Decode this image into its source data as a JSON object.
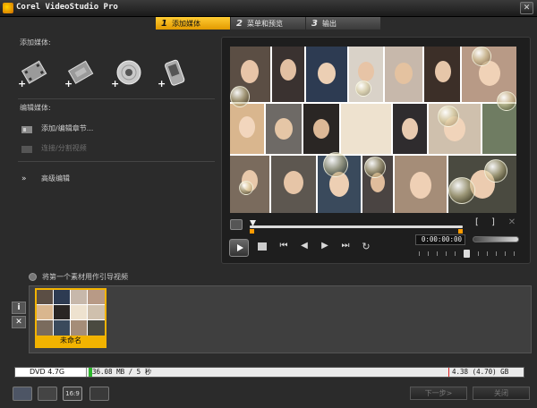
{
  "window": {
    "title": "Corel VideoStudio Pro",
    "close_label": "✕"
  },
  "steps": [
    {
      "num": "1",
      "label": "添加媒体",
      "active": true
    },
    {
      "num": "2",
      "label": "菜单和预览",
      "active": false
    },
    {
      "num": "3",
      "label": "输出",
      "active": false
    }
  ],
  "left": {
    "add_media_label": "添加媒体:",
    "edit_media_label": "编辑媒体:",
    "actions": {
      "add_edit_chapters": "添加/编辑章节...",
      "split_video": "连接/分割视频",
      "advanced_edit": "高级编辑"
    }
  },
  "player": {
    "timecode": "0:00:00:00",
    "mark_in": "[",
    "mark_out": "]"
  },
  "storyboard": {
    "intro_checkbox_label": "将第一个素材用作引导视频",
    "info_label": "i",
    "delete_label": "✕",
    "clip_caption": "未命名"
  },
  "capacity": {
    "disc": "DVD 4.7G",
    "used": "36.08 MB / 5 秒",
    "total": "4.38 (4.70) GB",
    "fill_fraction": 0.008
  },
  "footer": {
    "next_label": "下一步>",
    "close_label": "关闭"
  },
  "colors": {
    "accent": "#f2b300",
    "bg": "#2b2b2b"
  }
}
